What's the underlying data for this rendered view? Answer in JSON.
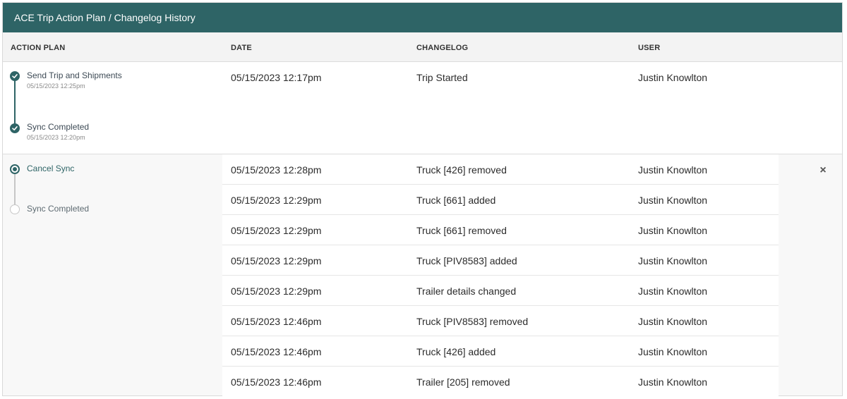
{
  "window": {
    "title": "ACE Trip Action Plan / Changelog History"
  },
  "columns": {
    "action_plan": "ACTION PLAN",
    "date": "DATE",
    "changelog": "CHANGELOG",
    "user": "USER"
  },
  "groups": [
    {
      "steps": [
        {
          "label": "Send Trip and Shipments",
          "date": "05/15/2023 12:25pm",
          "status": "done"
        },
        {
          "label": "Sync Completed",
          "date": "05/15/2023 12:20pm",
          "status": "done"
        }
      ],
      "entries": [
        {
          "date": "05/15/2023 12:17pm",
          "changelog": "Trip Started",
          "user": "Justin Knowlton"
        }
      ]
    },
    {
      "steps": [
        {
          "label": "Cancel Sync",
          "status": "current"
        },
        {
          "label": "Sync Completed",
          "status": "pending"
        }
      ],
      "entries": [
        {
          "date": "05/15/2023 12:28pm",
          "changelog": "Truck [426] removed",
          "user": "Justin Knowlton"
        },
        {
          "date": "05/15/2023 12:29pm",
          "changelog": "Truck [661] added",
          "user": "Justin Knowlton"
        },
        {
          "date": "05/15/2023 12:29pm",
          "changelog": "Truck [661] removed",
          "user": "Justin Knowlton"
        },
        {
          "date": "05/15/2023 12:29pm",
          "changelog": "Truck [PIV8583] added",
          "user": "Justin Knowlton"
        },
        {
          "date": "05/15/2023 12:29pm",
          "changelog": "Trailer details changed",
          "user": "Justin Knowlton"
        },
        {
          "date": "05/15/2023 12:46pm",
          "changelog": "Truck [PIV8583] removed",
          "user": "Justin Knowlton"
        },
        {
          "date": "05/15/2023 12:46pm",
          "changelog": "Truck [426] added",
          "user": "Justin Knowlton"
        },
        {
          "date": "05/15/2023 12:46pm",
          "changelog": "Trailer [205] removed",
          "user": "Justin Knowlton"
        }
      ]
    }
  ],
  "close_icon": {
    "icon": "close-icon",
    "glyph": "×"
  },
  "colors": {
    "accent": "#2e6466",
    "header_bg": "#f3f3f3",
    "pending": "#c6c6c6"
  }
}
